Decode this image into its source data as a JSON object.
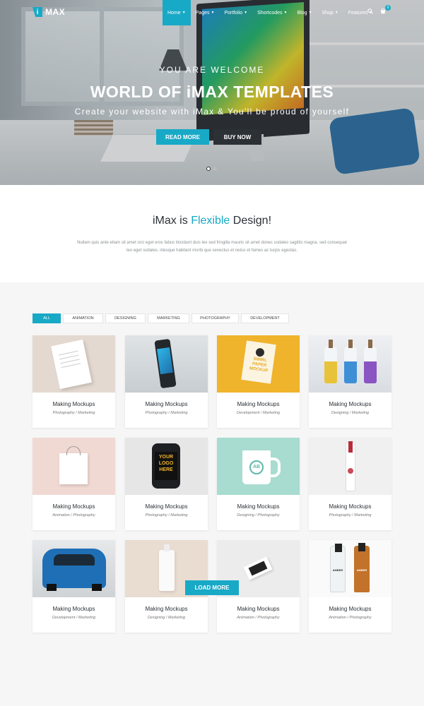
{
  "brand": {
    "logo_mark": "i",
    "logo_text": "MAX",
    "accent": "#18a9c7",
    "dark": "#2c3136"
  },
  "nav": {
    "items": [
      {
        "label": "Home",
        "active": true
      },
      {
        "label": "Pages"
      },
      {
        "label": "Portfolio"
      },
      {
        "label": "Shortcodes"
      },
      {
        "label": "Blog"
      },
      {
        "label": "Shop"
      },
      {
        "label": "Features"
      }
    ],
    "search_icon": "search-icon",
    "cart_icon": "cart-icon",
    "cart_count": "0"
  },
  "hero": {
    "subtitle": "YOU ARE WELCOME",
    "title": "WORLD OF iMAX TEMPLATES",
    "description": "Create your website with iMax & You'll be proud of yourself",
    "primary_button": "READ MORE",
    "secondary_button": "BUY NOW",
    "slides": 2,
    "active_slide": 1
  },
  "intro": {
    "title_pre": "iMax is ",
    "title_highlight": "Flexible",
    "title_post": " Design!",
    "text": "Nullam quis ante etiam sit amet orci eget eros fabus tincidunt duis leo sed fringilla mauris sit amet donec sodales sagittis magna. sed consequat leo eget sodales. ntesque habitant morbi que senectus et netus et fames ac turpis egestas."
  },
  "filters": [
    "ALL",
    "ANIMATION",
    "DESIGNING",
    "MARKETING",
    "PHOTOGRAPHY",
    "DEVELOPMENT"
  ],
  "active_filter": "ALL",
  "portfolio": [
    {
      "title": "Making Mockups",
      "category": "Photography / Marketing"
    },
    {
      "title": "Making Mockups",
      "category": "Photography / Marketing"
    },
    {
      "title": "Making Mockups",
      "category": "Development / Marketing",
      "thumb_text": "SWIRL PAPER MOCKUP"
    },
    {
      "title": "Making Mockups",
      "category": "Designing / Marketing"
    },
    {
      "title": "Making Mockups",
      "category": "Animation / Photography"
    },
    {
      "title": "Making Mockups",
      "category": "Photography / Marketing",
      "thumb_text": "YOUR LOGO HERE"
    },
    {
      "title": "Making Mockups",
      "category": "Designing / Photography",
      "thumb_text": "AB"
    },
    {
      "title": "Making Mockups",
      "category": "Photography / Marketing"
    },
    {
      "title": "Making Mockups",
      "category": "Development / Marketing"
    },
    {
      "title": "Making Mockups",
      "category": "Designing / Marketing"
    },
    {
      "title": "Making Mockups",
      "category": "Animation / Photography"
    },
    {
      "title": "Making Mockups",
      "category": "Animation / Photography",
      "thumb_text": "AMBER"
    }
  ],
  "load_more": "LOAD MORE"
}
